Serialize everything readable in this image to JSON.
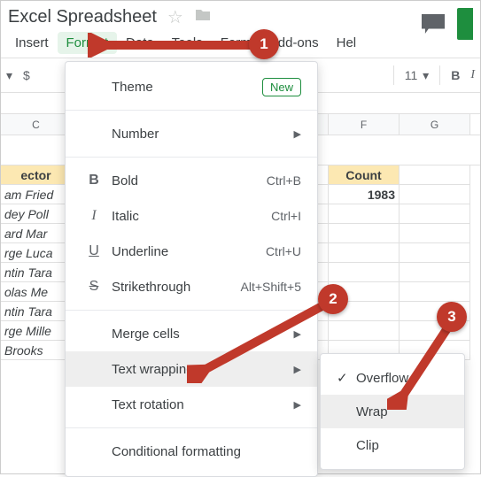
{
  "doc": {
    "title": "Excel Spreadsheet"
  },
  "menubar": {
    "insert": "Insert",
    "format": "Format",
    "data": "Data",
    "tools": "Tools",
    "form": "Form",
    "addons": "Add-ons",
    "help": "Hel"
  },
  "toolbar": {
    "dollar": "$",
    "fontsize": "11",
    "bold": "B",
    "italic": "I"
  },
  "columns": {
    "c": "C",
    "f": "F",
    "g": "G"
  },
  "table": {
    "hdrA": "ector",
    "hdrB": "Count",
    "valB": "1983",
    "rows": [
      "am Fried",
      "dey Poll",
      "ard Mar",
      "rge Luca",
      "ntin Tara",
      "olas Me",
      "ntin Tara",
      "rge Mille",
      "Brooks"
    ]
  },
  "menu": {
    "theme": "Theme",
    "new": "New",
    "number": "Number",
    "bold": "Bold",
    "bold_sc": "Ctrl+B",
    "italic": "Italic",
    "italic_sc": "Ctrl+I",
    "underline": "Underline",
    "underline_sc": "Ctrl+U",
    "strike": "Strikethrough",
    "strike_sc": "Alt+Shift+5",
    "merge": "Merge cells",
    "wrap": "Text wrapping",
    "rot": "Text rotation",
    "cond": "Conditional formatting"
  },
  "submenu": {
    "overflow": "Overflow",
    "wrap": "Wrap",
    "clip": "Clip"
  },
  "callouts": {
    "one": "1",
    "two": "2",
    "three": "3"
  }
}
